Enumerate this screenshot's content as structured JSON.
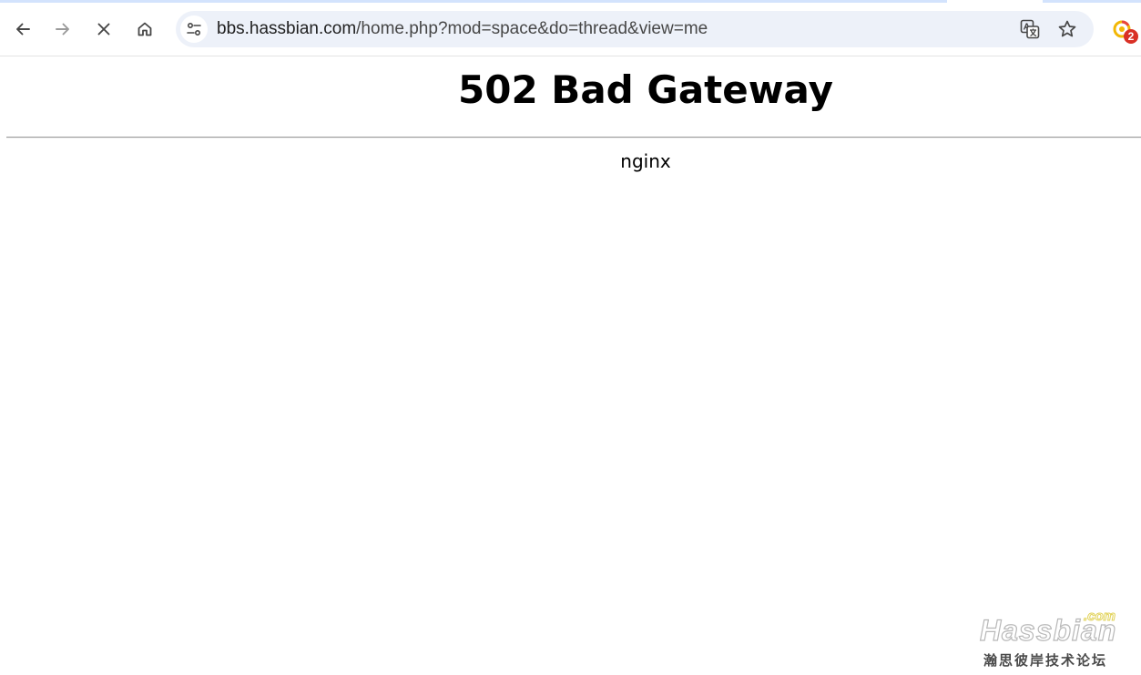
{
  "browser": {
    "url_host": "bbs.hassbian.com",
    "url_path": "/home.php?mod=space&do=thread&view=me",
    "extension_badge": "2",
    "icons": {
      "back": "arrow-left-icon",
      "forward": "arrow-right-icon",
      "stop": "close-icon",
      "home": "home-icon",
      "site_info": "tune-icon",
      "translate": "translate-icon",
      "bookmark": "star-icon",
      "extension": "extension-icon"
    },
    "colors": {
      "omnibox_bg": "#edf1f9",
      "badge": "#d93025",
      "top_stripe": "#d3e3fd"
    }
  },
  "page": {
    "heading": "502 Bad Gateway",
    "server": "nginx"
  },
  "watermark": {
    "domain_suffix": ".com",
    "name": "Hassbian",
    "tagline": "瀚思彼岸技术论坛"
  }
}
